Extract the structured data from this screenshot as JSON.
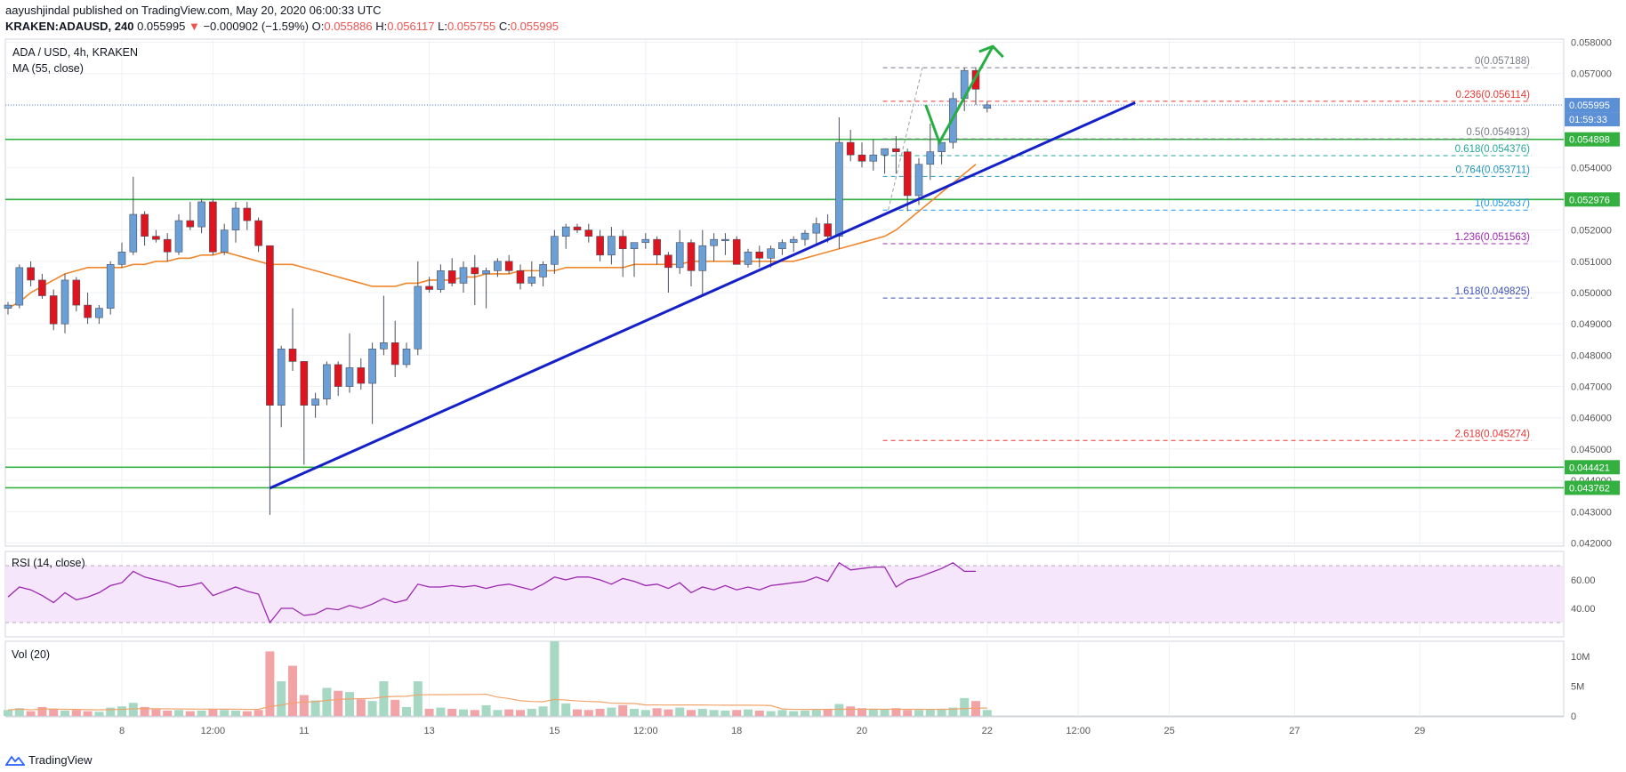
{
  "header": {
    "line1": "aayushjindal published on TradingView.com, May 20, 2020 06:00:33 UTC",
    "symbol": "KRAKEN:ADAUSD, 240",
    "last": "0.055995",
    "arrow": "▼",
    "change": "−0.000902 (−1.59%)",
    "o_label": "O:",
    "o_val": "0.055886",
    "h_label": "H:",
    "h_val": "0.056117",
    "l_label": "L:",
    "l_val": "0.055755",
    "c_label": "C:",
    "c_val": "0.055995"
  },
  "legend": {
    "pair": "ADA / USD, 4h, KRAKEN",
    "ma": "MA (55, close)",
    "rsi": "RSI (14, close)",
    "vol": "Vol (20)"
  },
  "footer": {
    "brand": "TradingView"
  },
  "colors": {
    "up": "#6a9fd8",
    "down": "#e0141e",
    "ma": "#f0862c",
    "trendline": "#1420c8",
    "support": "#33b040",
    "arrow": "#27ae43",
    "rsi": "#9b27af",
    "vol_up": "#a6d8c4",
    "vol_down": "#f2a3a6"
  },
  "chart_data": {
    "type": "candlestick",
    "y_range": [
      0.0419,
      0.0581
    ],
    "price_ticks": [
      "0.058000",
      "0.057000",
      "0.056000",
      "0.055000",
      "0.054000",
      "0.053000",
      "0.052000",
      "0.051000",
      "0.050000",
      "0.049000",
      "0.048000",
      "0.047000",
      "0.046000",
      "0.045000",
      "0.044000",
      "0.043000",
      "0.042000"
    ],
    "x_ticks": [
      {
        "label": "8",
        "i": 10
      },
      {
        "label": "12:00",
        "i": 18
      },
      {
        "label": "11",
        "i": 26
      },
      {
        "label": "13",
        "i": 37
      },
      {
        "label": "15",
        "i": 48
      },
      {
        "label": "12:00",
        "i": 56
      },
      {
        "label": "18",
        "i": 64
      },
      {
        "label": "20",
        "i": 75
      },
      {
        "label": "22",
        "i": 86
      },
      {
        "label": "12:00",
        "i": 94
      },
      {
        "label": "25",
        "i": 102
      },
      {
        "label": "27",
        "i": 113
      },
      {
        "label": "29",
        "i": 124
      }
    ],
    "candles": [
      [
        0.0495,
        0.0497,
        0.0493,
        0.0496
      ],
      [
        0.0496,
        0.0509,
        0.0495,
        0.0508
      ],
      [
        0.0508,
        0.051,
        0.0502,
        0.0504
      ],
      [
        0.0504,
        0.0506,
        0.0498,
        0.0499
      ],
      [
        0.0499,
        0.0501,
        0.0488,
        0.049
      ],
      [
        0.049,
        0.0506,
        0.0487,
        0.0504
      ],
      [
        0.0504,
        0.0505,
        0.0494,
        0.0496
      ],
      [
        0.0496,
        0.05,
        0.049,
        0.0492
      ],
      [
        0.0492,
        0.0496,
        0.049,
        0.0495
      ],
      [
        0.0495,
        0.051,
        0.0493,
        0.0509
      ],
      [
        0.0509,
        0.0516,
        0.0508,
        0.0513
      ],
      [
        0.0513,
        0.0537,
        0.0512,
        0.0525
      ],
      [
        0.0525,
        0.0526,
        0.0515,
        0.0518
      ],
      [
        0.0518,
        0.052,
        0.0516,
        0.0517
      ],
      [
        0.0517,
        0.0519,
        0.051,
        0.0513
      ],
      [
        0.0513,
        0.0525,
        0.0512,
        0.0523
      ],
      [
        0.0523,
        0.0529,
        0.052,
        0.0521
      ],
      [
        0.0521,
        0.053,
        0.0519,
        0.0529
      ],
      [
        0.0529,
        0.053,
        0.0512,
        0.0513
      ],
      [
        0.0513,
        0.0522,
        0.0512,
        0.052
      ],
      [
        0.052,
        0.0529,
        0.0516,
        0.0527
      ],
      [
        0.0527,
        0.0529,
        0.052,
        0.0523
      ],
      [
        0.0523,
        0.0524,
        0.0513,
        0.0515
      ],
      [
        0.0515,
        0.0515,
        0.0429,
        0.0464
      ],
      [
        0.0464,
        0.0483,
        0.0457,
        0.0482
      ],
      [
        0.0482,
        0.0495,
        0.0475,
        0.0478
      ],
      [
        0.0478,
        0.0478,
        0.0445,
        0.0464
      ],
      [
        0.0464,
        0.0468,
        0.046,
        0.0466
      ],
      [
        0.0466,
        0.0478,
        0.0464,
        0.0477
      ],
      [
        0.0477,
        0.0478,
        0.0467,
        0.047
      ],
      [
        0.047,
        0.0487,
        0.0468,
        0.0476
      ],
      [
        0.0476,
        0.0479,
        0.0469,
        0.0471
      ],
      [
        0.0471,
        0.0484,
        0.0458,
        0.0482
      ],
      [
        0.0482,
        0.0499,
        0.048,
        0.0484
      ],
      [
        0.0484,
        0.0491,
        0.0473,
        0.0477
      ],
      [
        0.0477,
        0.0484,
        0.0476,
        0.0482
      ],
      [
        0.0482,
        0.051,
        0.048,
        0.0502
      ],
      [
        0.0502,
        0.0505,
        0.05,
        0.0501
      ],
      [
        0.0501,
        0.0509,
        0.05,
        0.0507
      ],
      [
        0.0507,
        0.0511,
        0.0502,
        0.0503
      ],
      [
        0.0503,
        0.051,
        0.05,
        0.0508
      ],
      [
        0.0508,
        0.0512,
        0.0496,
        0.0506
      ],
      [
        0.0506,
        0.0508,
        0.0495,
        0.0507
      ],
      [
        0.0507,
        0.0511,
        0.0505,
        0.051
      ],
      [
        0.051,
        0.0512,
        0.0506,
        0.0507
      ],
      [
        0.0507,
        0.0509,
        0.0501,
        0.0503
      ],
      [
        0.0503,
        0.051,
        0.0502,
        0.0505
      ],
      [
        0.0505,
        0.051,
        0.0502,
        0.0509
      ],
      [
        0.0509,
        0.052,
        0.0506,
        0.0518
      ],
      [
        0.0518,
        0.0522,
        0.0514,
        0.0521
      ],
      [
        0.0521,
        0.0522,
        0.0519,
        0.052
      ],
      [
        0.052,
        0.0522,
        0.0516,
        0.0518
      ],
      [
        0.0518,
        0.052,
        0.051,
        0.0512
      ],
      [
        0.0512,
        0.0521,
        0.0509,
        0.0518
      ],
      [
        0.0518,
        0.052,
        0.0505,
        0.0514
      ],
      [
        0.0514,
        0.0515,
        0.0505,
        0.0516
      ],
      [
        0.0516,
        0.0519,
        0.0514,
        0.0517
      ],
      [
        0.0517,
        0.0518,
        0.0509,
        0.0512
      ],
      [
        0.0512,
        0.0513,
        0.05,
        0.0508
      ],
      [
        0.0508,
        0.052,
        0.0506,
        0.0516
      ],
      [
        0.0516,
        0.0517,
        0.0502,
        0.0507
      ],
      [
        0.0507,
        0.052,
        0.0499,
        0.0515
      ],
      [
        0.0515,
        0.0519,
        0.051,
        0.0517
      ],
      [
        0.0517,
        0.0519,
        0.0512,
        0.0517
      ],
      [
        0.0517,
        0.0518,
        0.0513,
        0.0509
      ],
      [
        0.0509,
        0.0514,
        0.0508,
        0.0513
      ],
      [
        0.0513,
        0.0515,
        0.0508,
        0.0511
      ],
      [
        0.0511,
        0.0515,
        0.0508,
        0.0514
      ],
      [
        0.0514,
        0.0517,
        0.0512,
        0.0516
      ],
      [
        0.0516,
        0.0518,
        0.0513,
        0.0517
      ],
      [
        0.0517,
        0.052,
        0.0515,
        0.0519
      ],
      [
        0.0519,
        0.0524,
        0.0515,
        0.0522
      ],
      [
        0.0522,
        0.0525,
        0.0516,
        0.0518
      ],
      [
        0.0518,
        0.0556,
        0.0514,
        0.0548
      ],
      [
        0.0548,
        0.0552,
        0.0542,
        0.0544
      ],
      [
        0.0544,
        0.0548,
        0.054,
        0.0542
      ],
      [
        0.0542,
        0.0549,
        0.0539,
        0.0544
      ],
      [
        0.0544,
        0.0546,
        0.0538,
        0.0546
      ],
      [
        0.0546,
        0.055,
        0.0538,
        0.0545
      ],
      [
        0.0545,
        0.0546,
        0.0526,
        0.0531
      ],
      [
        0.0531,
        0.0543,
        0.0528,
        0.0541
      ],
      [
        0.0541,
        0.0554,
        0.0536,
        0.0545
      ],
      [
        0.0545,
        0.0547,
        0.0541,
        0.0548
      ],
      [
        0.0548,
        0.0564,
        0.0546,
        0.0562
      ],
      [
        0.0562,
        0.05718,
        0.0558,
        0.0571
      ],
      [
        0.0571,
        0.0572,
        0.056,
        0.0565
      ],
      [
        0.05589,
        0.05612,
        0.05576,
        0.056
      ]
    ],
    "ma55": [
      0.0495,
      0.0497,
      0.05,
      0.0502,
      0.0504,
      0.0506,
      0.0507,
      0.0508,
      0.0508,
      0.0508,
      0.0508,
      0.0509,
      0.0509,
      0.051,
      0.051,
      0.0511,
      0.0511,
      0.0512,
      0.0512,
      0.0513,
      0.0512,
      0.0511,
      0.051,
      0.0509,
      0.0509,
      0.0509,
      0.0508,
      0.0507,
      0.0506,
      0.0505,
      0.0504,
      0.0503,
      0.0502,
      0.0502,
      0.0502,
      0.0503,
      0.0503,
      0.0504,
      0.0504,
      0.0504,
      0.0505,
      0.0505,
      0.0506,
      0.0506,
      0.0506,
      0.0507,
      0.0507,
      0.0507,
      0.0507,
      0.0508,
      0.0508,
      0.0508,
      0.0508,
      0.0508,
      0.0508,
      0.0509,
      0.0509,
      0.0509,
      0.0509,
      0.0509,
      0.051,
      0.051,
      0.051,
      0.051,
      0.051,
      0.051,
      0.051,
      0.051,
      0.051,
      0.051,
      0.0511,
      0.0512,
      0.0513,
      0.0514,
      0.0515,
      0.0516,
      0.0517,
      0.0518,
      0.052,
      0.0523,
      0.0526,
      0.0529,
      0.0532,
      0.0535,
      0.0538,
      0.0541
    ],
    "rsi_range": [
      20,
      80
    ],
    "rsi_ticks": [
      "60.00",
      "40.00"
    ],
    "rsi": [
      48,
      55,
      53,
      49,
      44,
      51,
      46,
      48,
      51,
      56,
      58,
      66,
      62,
      60,
      58,
      55,
      56,
      58,
      49,
      52,
      55,
      52,
      50,
      30,
      40,
      40,
      35,
      36,
      40,
      39,
      42,
      40,
      43,
      47,
      44,
      46,
      57,
      55,
      55,
      56,
      55,
      56,
      54,
      56,
      57,
      55,
      53,
      57,
      62,
      60,
      62,
      62,
      60,
      57,
      61,
      59,
      56,
      57,
      54,
      58,
      51,
      55,
      53,
      56,
      53,
      55,
      53,
      56,
      57,
      58,
      59,
      62,
      59,
      72,
      67,
      68,
      69,
      69,
      55,
      60,
      62,
      65,
      68,
      72,
      66,
      66
    ],
    "vol_range": [
      0,
      12.5
    ],
    "vol_ticks": [
      "10M",
      "5M",
      "0"
    ],
    "volume": [
      1.0,
      1.3,
      0.8,
      1.5,
      1.2,
      0.9,
      1.0,
      0.8,
      0.7,
      1.4,
      1.6,
      2.2,
      1.5,
      1.1,
      0.9,
      1.0,
      0.8,
      0.9,
      1.2,
      1.0,
      0.9,
      0.8,
      1.0,
      10.8,
      5.8,
      8.4,
      3.5,
      2.6,
      4.7,
      4.2,
      4.0,
      2.8,
      2.5,
      5.8,
      2.7,
      1.5,
      5.8,
      1.2,
      1.4,
      1.2,
      1.1,
      1.0,
      1.8,
      1.0,
      1.1,
      1.0,
      1.2,
      1.6,
      12.5,
      2.1,
      1.1,
      1.0,
      1.2,
      1.4,
      1.8,
      1.2,
      1.0,
      1.3,
      1.1,
      1.4,
      1.0,
      1.2,
      1.0,
      0.9,
      1.0,
      1.1,
      0.9,
      0.8,
      1.0,
      0.8,
      0.9,
      1.0,
      1.2,
      2.0,
      1.6,
      1.3,
      1.2,
      1.1,
      1.3,
      1.0,
      1.0,
      1.1,
      1.2,
      1.4,
      3.0,
      2.5,
      1.0
    ],
    "last_price_line": 0.055995,
    "support_lines": [
      0.054898,
      0.052976,
      0.044421,
      0.043762
    ],
    "fib": [
      {
        "label": "0(0.057188)",
        "v": 0.057188,
        "color": "#787b86"
      },
      {
        "label": "0.236(0.056114)",
        "v": 0.056114,
        "color": "#e53935"
      },
      {
        "label": "0.5(0.054913)",
        "v": 0.054913,
        "color": "#787b86"
      },
      {
        "label": "0.618(0.054376)",
        "v": 0.054376,
        "color": "#26a69a"
      },
      {
        "label": "0.764(0.053711)",
        "v": 0.053711,
        "color": "#2196b6"
      },
      {
        "label": "1(0.052637)",
        "v": 0.052637,
        "color": "#2196f3"
      },
      {
        "label": "1.236(0.051563)",
        "v": 0.051563,
        "color": "#9c27b0"
      },
      {
        "label": "1.618(0.049825)",
        "v": 0.049825,
        "color": "#3f51b5"
      },
      {
        "label": "2.618(0.045274)",
        "v": 0.045274,
        "color": "#e53935"
      }
    ],
    "price_labels": [
      {
        "text": "0.055995",
        "v": 0.055995,
        "bg": "#5b8fd6",
        "fg": "#ffffff"
      },
      {
        "text": "01:59:33",
        "v": 0.05554,
        "bg": "#5b8fd6",
        "fg": "#ffffff"
      },
      {
        "text": "0.054898",
        "v": 0.054898,
        "bg": "#33b040",
        "fg": "#ffffff"
      },
      {
        "text": "0.052976",
        "v": 0.052976,
        "bg": "#33b040",
        "fg": "#ffffff"
      },
      {
        "text": "0.044421",
        "v": 0.044421,
        "bg": "#33b040",
        "fg": "#ffffff"
      },
      {
        "text": "0.043762",
        "v": 0.043762,
        "bg": "#33b040",
        "fg": "#ffffff"
      }
    ],
    "trendline": [
      [
        23,
        0.04375
      ],
      [
        99,
        0.05607
      ]
    ]
  }
}
